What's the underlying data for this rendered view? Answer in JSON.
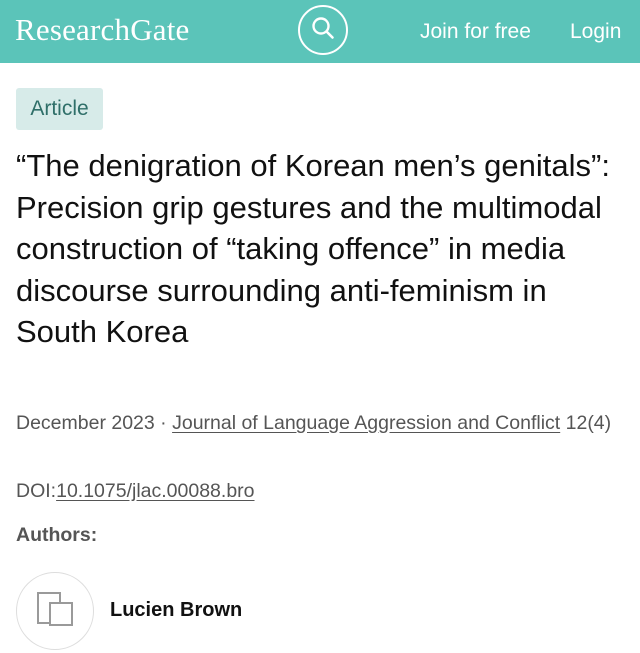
{
  "header": {
    "brand": "ResearchGate",
    "search_icon": "search-icon",
    "join_label": "Join for free",
    "login_label": "Login",
    "background_color": "#5bc4b9"
  },
  "article": {
    "type_badge": "Article",
    "title": "“The denigration of Korean men’s genitals”: Precision grip gestures and the multimodal construction of “taking offence” in media discourse surrounding anti-feminism in South Korea",
    "date": "December 2023",
    "separator": " · ",
    "journal": "Journal of Language Aggression and Conflict",
    "issue": "12(4)",
    "doi_label": "DOI:",
    "doi_value": "10.1075/jlac.00088.bro"
  },
  "authors": {
    "heading": "Authors:",
    "list": [
      {
        "name": "Lucien Brown",
        "avatar_icon": "placeholder-avatar-icon"
      }
    ]
  }
}
